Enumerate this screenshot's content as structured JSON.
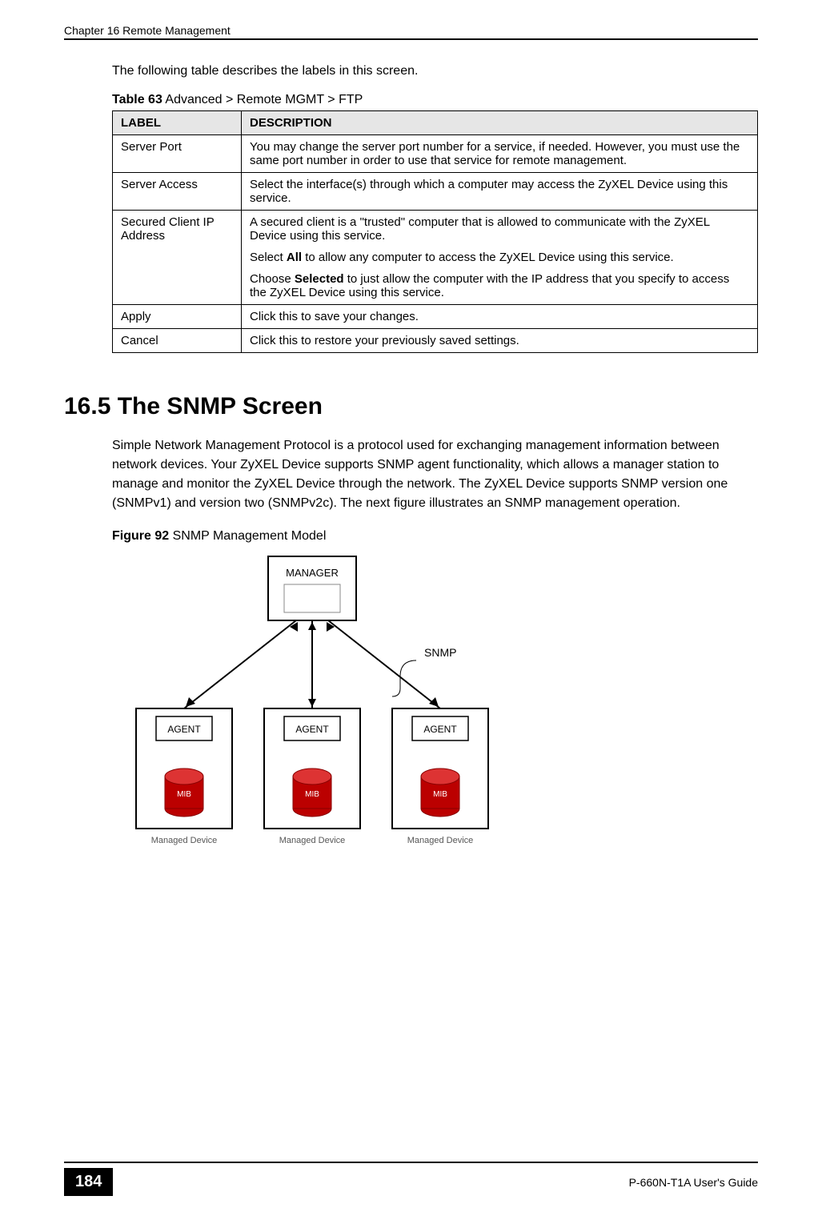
{
  "header": {
    "chapter": "Chapter 16 Remote Management"
  },
  "intro": "The following table describes the labels in this screen.",
  "table": {
    "caption_bold": "Table 63",
    "caption_rest": "   Advanced > Remote MGMT > FTP",
    "head_label": "LABEL",
    "head_desc": "DESCRIPTION",
    "rows": [
      {
        "label": "Server Port",
        "paras": [
          "You may change the server port number for a service, if needed. However, you must use the same port number in order to use that service for remote management."
        ]
      },
      {
        "label": "Server Access",
        "paras": [
          "Select the interface(s) through which a computer may access the ZyXEL Device using this service."
        ]
      },
      {
        "label": "Secured Client IP Address",
        "paras": [
          "A secured client is a \"trusted\" computer that is allowed to communicate with the ZyXEL Device using this service.",
          "Select All to allow any computer to access the ZyXEL Device using this service.",
          "Choose Selected to just allow the computer with the IP address that you specify to access the ZyXEL Device using this service."
        ],
        "bold_words": [
          "All",
          "Selected"
        ]
      },
      {
        "label": "Apply",
        "paras": [
          "Click this to save your changes."
        ]
      },
      {
        "label": "Cancel",
        "paras": [
          "Click this to restore your previously saved settings."
        ]
      }
    ]
  },
  "section": {
    "heading": "16.5  The SNMP Screen",
    "body": "Simple Network Management Protocol is a protocol used for exchanging management information between network devices. Your ZyXEL Device supports SNMP agent functionality, which allows a manager station to manage and monitor the ZyXEL Device through the network. The ZyXEL Device supports SNMP version one (SNMPv1) and version two (SNMPv2c). The next figure illustrates an SNMP management operation."
  },
  "figure": {
    "caption_bold": "Figure 92",
    "caption_rest": "   SNMP Management Model",
    "labels": {
      "manager": "MANAGER",
      "agent": "AGENT",
      "mib": "MIB",
      "managed_device": "Managed Device",
      "snmp": "SNMP"
    }
  },
  "footer": {
    "page_number": "184",
    "guide": "P-660N-T1A User's Guide"
  }
}
